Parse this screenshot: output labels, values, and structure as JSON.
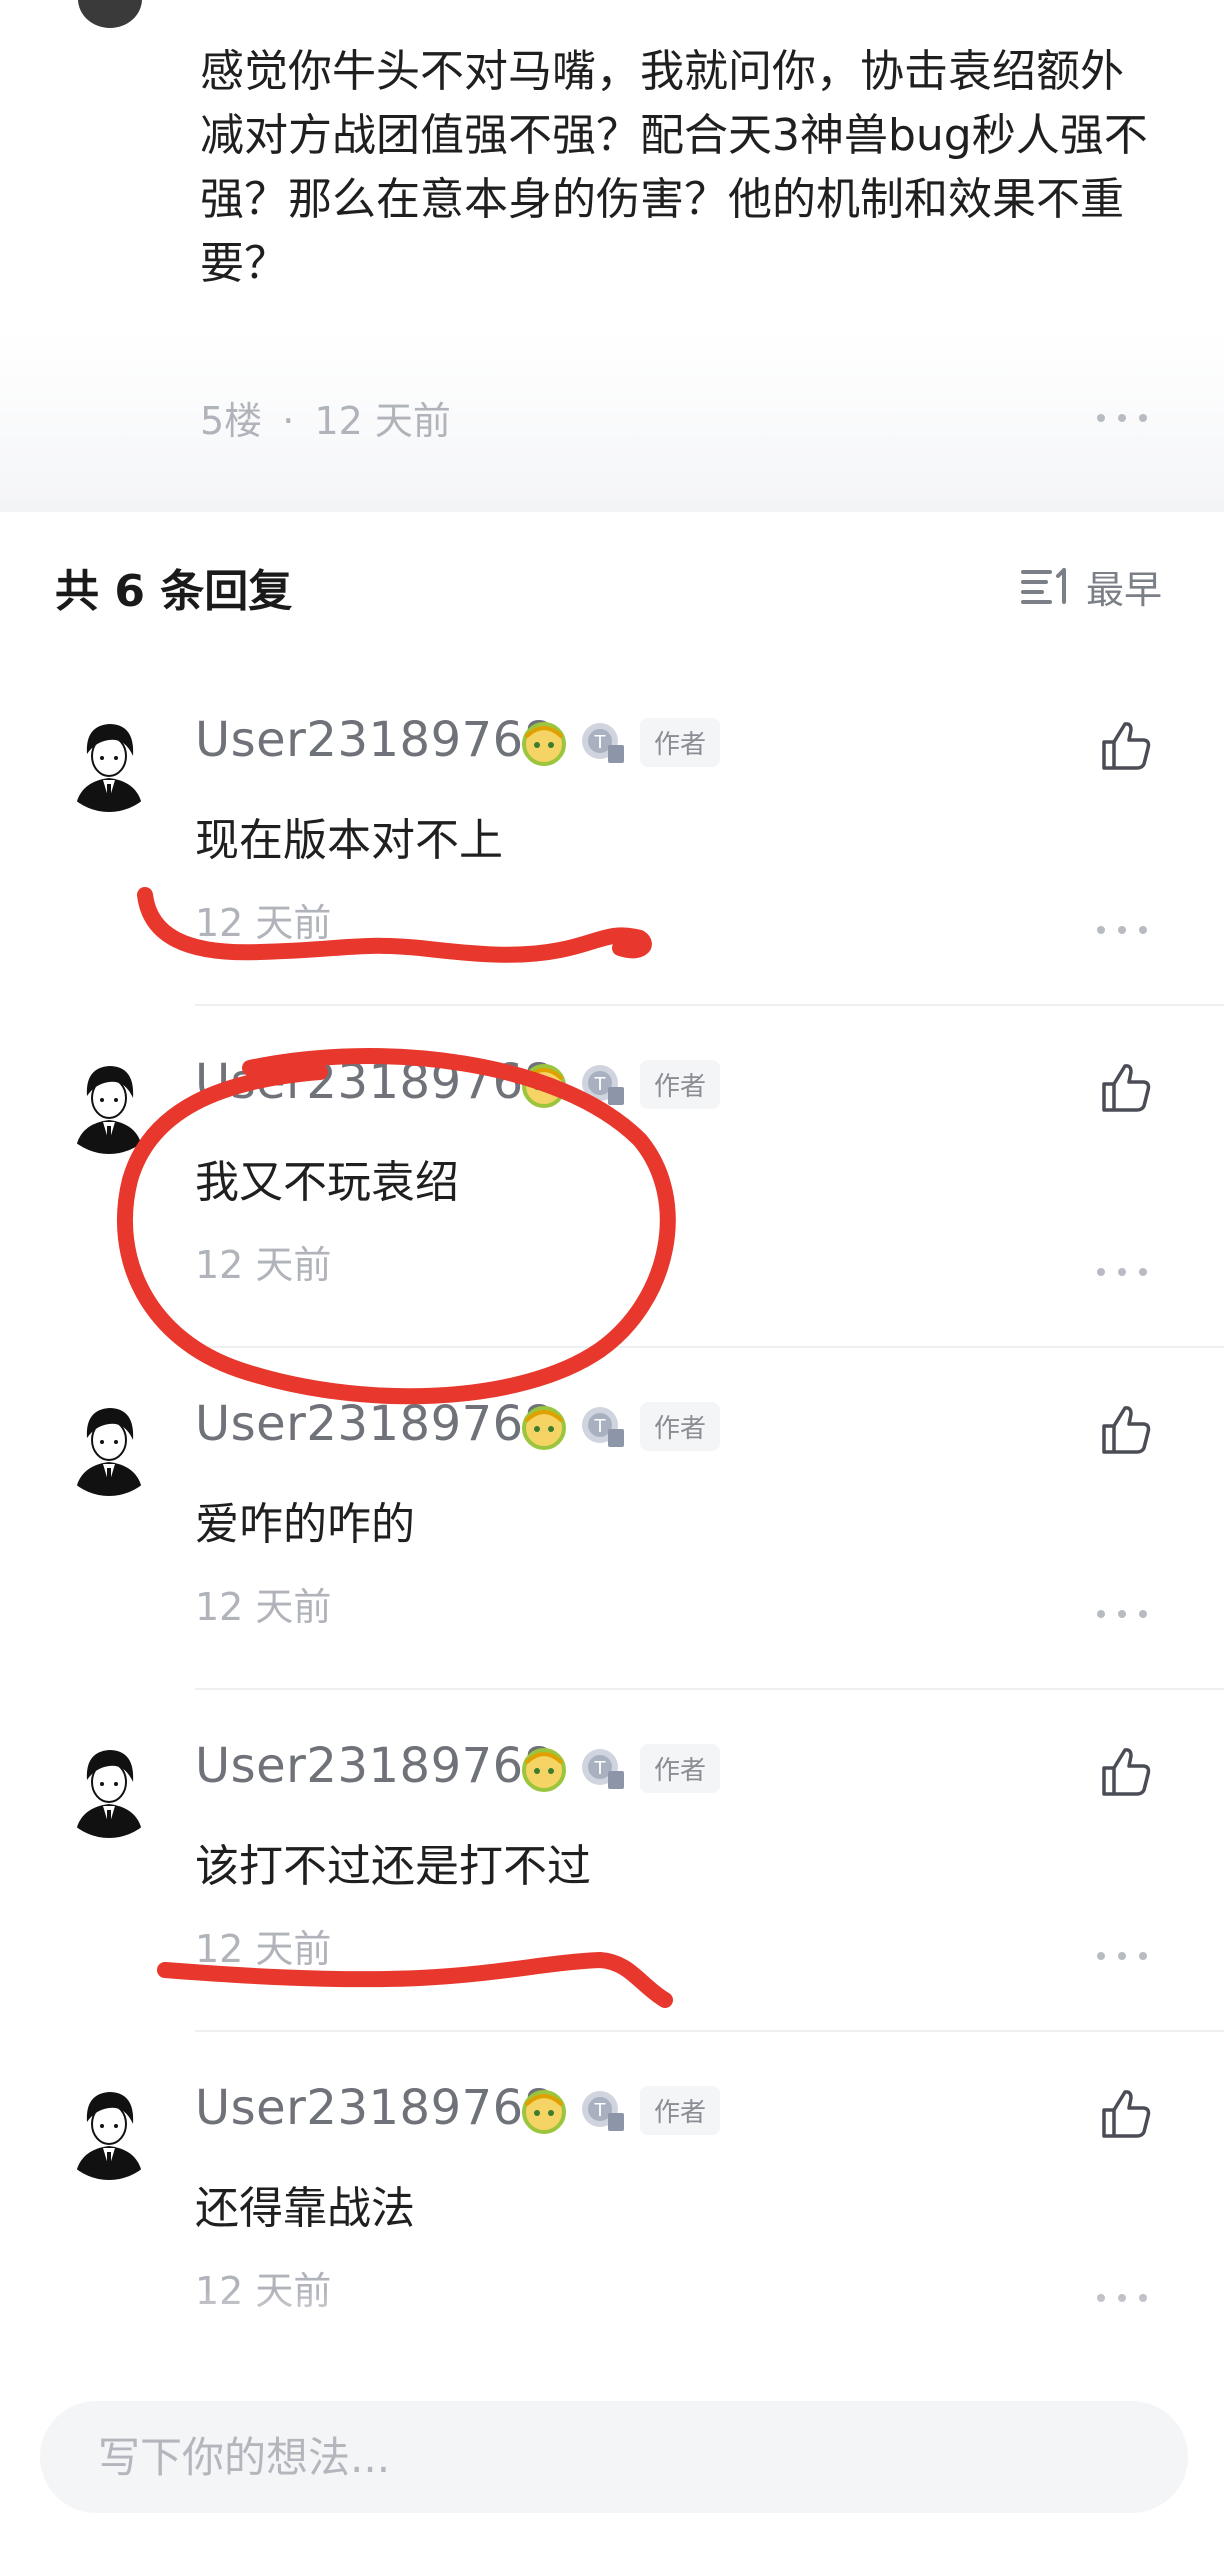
{
  "parent_comment": {
    "text": "感觉你牛头不对马嘴，我就问你，协击袁绍额外减对方战团值强不强？配合天3神兽bug秒人强不强？那么在意本身的伤害？他的机制和效果不重要？",
    "floor": "5楼",
    "separator": "·",
    "time": "12 天前"
  },
  "replies_header": {
    "title": "共 6 条回复",
    "sort_label": "最早",
    "sort_icon": "sort-list-icon"
  },
  "replies": [
    {
      "username": "User23189768",
      "author_tag": "作者",
      "body": "现在版本对不上",
      "time": "12 天前"
    },
    {
      "username": "User23189768",
      "author_tag": "作者",
      "body": "我又不玩袁绍",
      "time": "12 天前"
    },
    {
      "username": "User23189768",
      "author_tag": "作者",
      "body": "爱咋的咋的",
      "time": "12 天前"
    },
    {
      "username": "User23189768",
      "author_tag": "作者",
      "body": "该打不过还是打不过",
      "time": "12 天前"
    },
    {
      "username": "User23189768",
      "author_tag": "作者",
      "body": "还得靠战法",
      "time": "12 天前"
    }
  ],
  "composer": {
    "placeholder": "写下你的想法..."
  },
  "colors": {
    "annotation_red": "#e8372c",
    "meta_gray": "#b0b3ba",
    "username_gray": "#6f7279"
  },
  "icons": [
    "thumbs-up-icon",
    "more-dots-icon",
    "sort-list-icon",
    "level-badge-icon",
    "avatar-badge-icon"
  ]
}
